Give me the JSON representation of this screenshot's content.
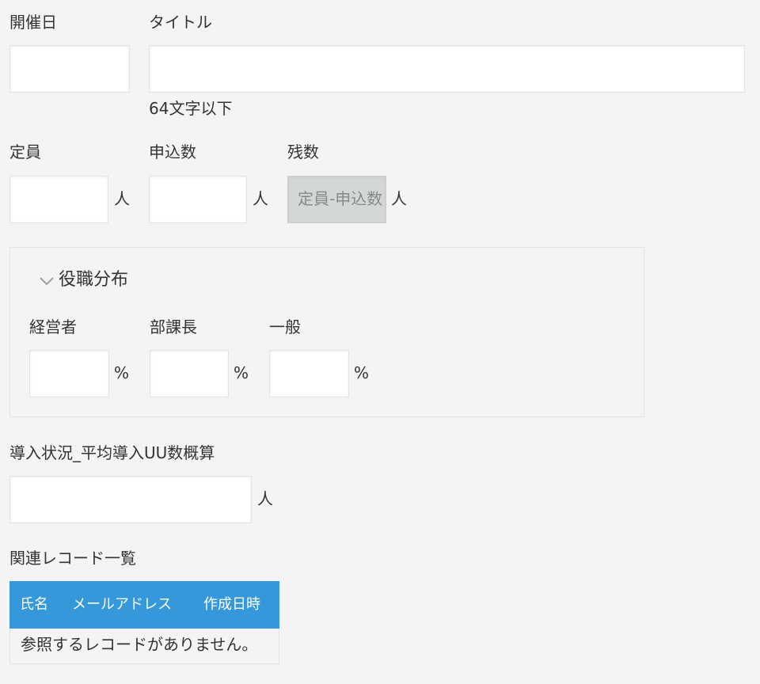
{
  "fields": {
    "date_label": "開催日",
    "title_label": "タイトル",
    "title_hint": "64文字以下",
    "capacity_label": "定員",
    "applications_label": "申込数",
    "remaining_label": "残数",
    "remaining_value": "定員-申込数",
    "person_unit": "人"
  },
  "position_group": {
    "title": "役職分布",
    "executive_label": "経営者",
    "manager_label": "部課長",
    "general_label": "一般",
    "percent_unit": "%"
  },
  "adoption": {
    "label": "導入状況_平均導入UU数概算",
    "unit": "人"
  },
  "related_records": {
    "label": "関連レコード一覧",
    "columns": [
      "氏名",
      "メールアドレス",
      "作成日時"
    ],
    "empty_message": "参照するレコードがありません。"
  },
  "colors": {
    "table_header": "#3498db",
    "background": "#f4f4f4",
    "disabled_input": "#d4d7d7"
  }
}
